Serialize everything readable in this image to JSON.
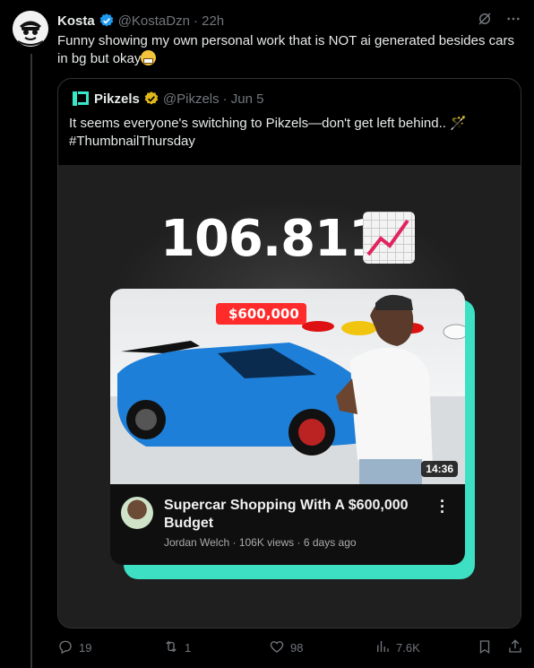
{
  "tweet": {
    "author_name": "Kosta",
    "handle": "@KostaDzn",
    "time": "· 22h",
    "text": "Funny showing my own personal work that is NOT ai generated besides cars in bg but okay"
  },
  "quote": {
    "author_name": "Pikzels",
    "handle": "@Pikzels",
    "time": "· Jun 5",
    "text_line1": "It seems everyone's switching to Pikzels—don't get left behind.. 🪄",
    "text_line2": "#ThumbnailThursday",
    "media": {
      "headline_number": "106.811",
      "price_tag": "$600,000",
      "video_duration": "14:36",
      "video_title": "Supercar Shopping With A $600,000 Budget",
      "channel_line": "Jordan Welch · 106K views · 6 days ago"
    }
  },
  "actions": {
    "replies": "19",
    "reposts": "1",
    "likes": "98",
    "views": "7.6K"
  },
  "colors": {
    "accent_verified": "#1d9bf0",
    "pikzels_badge": "#e2b719",
    "card_shadow": "#3de0c2",
    "price_tag": "#ff2a2a"
  },
  "icons": [
    "verified-icon",
    "grok-icon",
    "more-icon",
    "reply-icon",
    "repost-icon",
    "like-icon",
    "views-icon",
    "bookmark-icon",
    "share-icon",
    "chart-increasing-icon"
  ]
}
